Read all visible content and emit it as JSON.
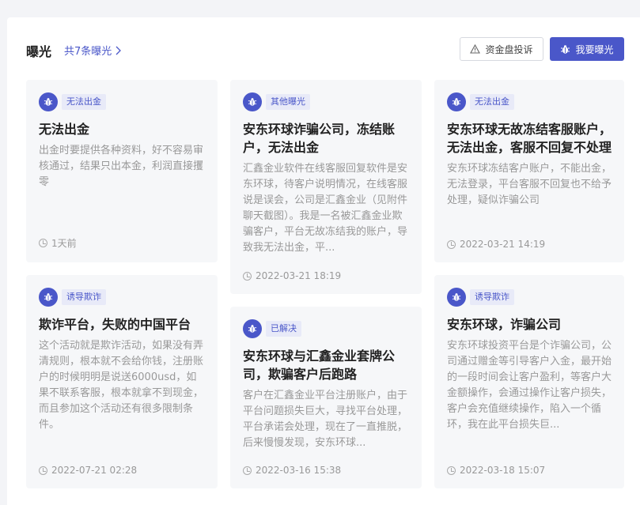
{
  "header": {
    "title": "曝光",
    "count_link": "共7条曝光",
    "complain_button": "资金盘投诉",
    "expose_button": "我要曝光"
  },
  "cards": [
    {
      "tag": "无法出金",
      "title": "无法出金",
      "desc": "出金时要提供各种资料，好不容易审核通过，结果只出本金，利润直接攫零",
      "time": "1天前"
    },
    {
      "tag": "其他曝光",
      "title": "安东环球诈骗公司，冻结账户，无法出金",
      "desc": "汇鑫金业软件在线客服回复软件是安东环球，待客户说明情况，在线客服说是误会，公司是汇鑫金业（见附件聊天截图）。我是一名被汇鑫金业欺骗客户，平台无故冻结我的账户，导致我无法出金，平...",
      "time": "2022-03-21 18:19"
    },
    {
      "tag": "无法出金",
      "title": "安东环球无故冻结客服账户，无法出金，客服不回复不处理",
      "desc": "安东环球冻结客户账户，不能出金，无法登录，平台客服不回复也不给予处理，疑似诈骗公司",
      "time": "2022-03-21 14:19"
    },
    {
      "tag": "诱导欺诈",
      "title": "欺诈平台，失败的中国平台",
      "desc": "这个活动就是欺诈活动，如果没有弄清规则，根本就不会给你钱，注册账户的时候明明是说送6000usd，如果不联系客服，根本就拿不到现金，而且参加这个活动还有很多限制条件。",
      "time": "2022-07-21 02:28"
    },
    {
      "tag": "已解决",
      "title": "安东环球与汇鑫金业套牌公司，欺骗客户后跑路",
      "desc": "客户在汇鑫金业平台注册账户，由于平台问题损失巨大，寻找平台处理，平台承诺会处理，现在了一直推脱，后来慢慢发现，安东环球...",
      "time": "2022-03-16 15:38"
    },
    {
      "tag": "诱导欺诈",
      "title": "安东环球，诈骗公司",
      "desc": "安东环球投资平台是个诈骗公司，公司通过赠金等引导客户入金，最开始的一段时间会让客户盈利，等客户大金额操作，会通过操作让客户损失，客户会充值继续操作，陷入一个循环，我在此平台损失巨...",
      "time": "2022-03-18 15:07"
    }
  ],
  "colors": {
    "accent": "#4a57c9",
    "tag_bg": "#e8eaf8"
  }
}
